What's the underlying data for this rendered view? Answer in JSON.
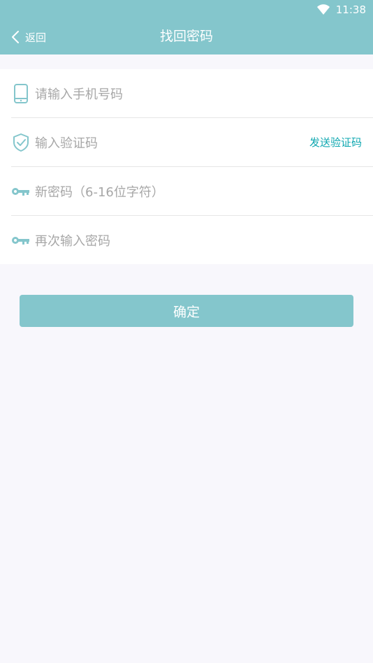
{
  "status_bar": {
    "time": "11:38",
    "wifi_icon": "wifi-icon"
  },
  "app_bar": {
    "back_label": "返回",
    "title": "找回密码"
  },
  "form": {
    "phone": {
      "placeholder": "请输入手机号码",
      "icon": "phone-icon"
    },
    "code": {
      "placeholder": "输入验证码",
      "icon": "shield-check-icon",
      "send_label": "发送验证码"
    },
    "new_password": {
      "placeholder": "新密码（6-16位字符）",
      "icon": "key-icon"
    },
    "confirm_password": {
      "placeholder": "再次输入密码",
      "icon": "key-icon"
    }
  },
  "confirm_button": {
    "label": "确定"
  },
  "colors": {
    "header": "#84c6cc",
    "accent_text": "#0ea7b0",
    "background": "#f8f7fc"
  }
}
